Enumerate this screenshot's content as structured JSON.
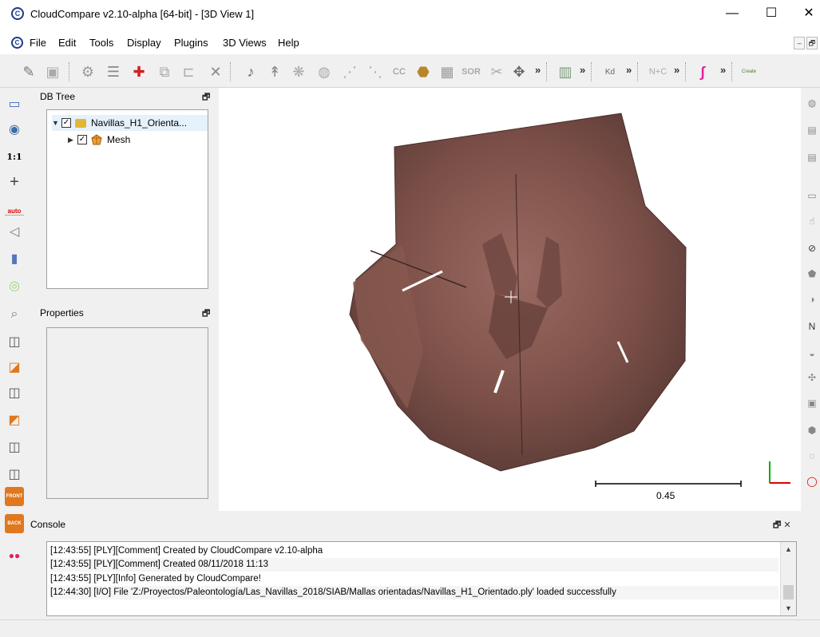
{
  "window": {
    "app_icon_glyph": "C",
    "title": "CloudCompare v2.10-alpha [64-bit] - [3D View 1]",
    "minimize": "—",
    "maximize": "☐",
    "close": "✕"
  },
  "menu": {
    "items": [
      "File",
      "Edit",
      "Tools",
      "Display",
      "Plugins",
      "3D Views",
      "Help"
    ],
    "mdi_min": "–",
    "mdi_restore": "🗗"
  },
  "toolbar": {
    "sor_label": "SOR",
    "kd_label": "Kd",
    "n_c_label": "N+C",
    "cc_label": "CC",
    "more": "»",
    "create_label": "Create"
  },
  "left_toolbar": {
    "one_to_one": "1:1",
    "auto": "auto",
    "front": "FRONT",
    "back": "BACK"
  },
  "db_tree": {
    "title": "DB Tree",
    "float_btn": "🗗",
    "root": "Navillas_H1_Orienta...",
    "child": "Mesh"
  },
  "properties": {
    "title": "Properties",
    "float_btn": "🗗"
  },
  "view3d": {
    "scale_value": "0.45"
  },
  "console": {
    "title": "Console",
    "buttons": "🗗 ✕",
    "lines": [
      "[12:43:55] [PLY][Comment] Created by CloudCompare v2.10-alpha",
      "[12:43:55] [PLY][Comment] Created 08/11/2018 11:13",
      "[12:43:55] [PLY][Info] Generated by CloudCompare!",
      "[12:44:30] [I/O] File 'Z:/Proyectos/Paleontología/Las_Navillas_2018/SIAB/Mallas orientadas/Navillas_H1_Orientado.ply' loaded successfully"
    ]
  },
  "colors": {
    "accent": "#1e3b8a",
    "mesh": "#8a5a52",
    "axis_x": "#e00000",
    "axis_y": "#00b000"
  }
}
